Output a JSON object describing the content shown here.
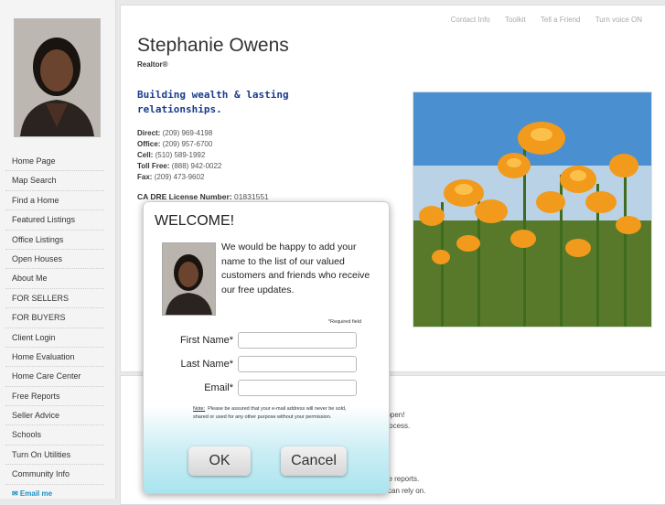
{
  "sidebar": {
    "nav_items": [
      "Home Page",
      "Map Search",
      "Find a Home",
      "Featured Listings",
      "Office Listings",
      "Open Houses",
      "About Me",
      "FOR SELLERS",
      "FOR BUYERS",
      "Client Login",
      "Home Evaluation",
      "Home Care Center",
      "Free Reports",
      "Seller Advice",
      "Schools",
      "Turn On Utilities",
      "Community Info"
    ],
    "email_link": "✉ Email me"
  },
  "top_links": [
    "Contact Info",
    "Toolkit",
    "Tell a Friend",
    "Turn voice ON"
  ],
  "profile": {
    "name": "Stephanie Owens",
    "title": "Realtor®",
    "tagline": "Building wealth & lasting relationships.",
    "phones": [
      {
        "label": "Direct:",
        "value": "(209) 969-4198"
      },
      {
        "label": "Office:",
        "value": "(209) 957-6700"
      },
      {
        "label": "Cell:",
        "value": "(510) 589-1992"
      },
      {
        "label": "Toll Free:",
        "value": "(888) 942-0022"
      },
      {
        "label": "Fax:",
        "value": "(209) 473-9602"
      }
    ],
    "license_label": "CA DRE License Number:",
    "license_value": "01831551"
  },
  "partial_text": {
    "happen": "appen!",
    "process": "process.",
    "reports": "ee reports.",
    "relyon": "can rely on."
  },
  "modal": {
    "title": "WELCOME!",
    "message": "We would be happy to add your name to the list of our valued customers and friends who receive our free updates.",
    "required_note": "*Required field",
    "fields": [
      {
        "label": "First Name*",
        "value": ""
      },
      {
        "label": "Last Name*",
        "value": ""
      },
      {
        "label": "Email*",
        "value": ""
      }
    ],
    "note_label": "Note:",
    "note_text": "Please be assured that your e-mail address will never be sold, shared or used for any other purpose without your permission.",
    "ok_label": "OK",
    "cancel_label": "Cancel"
  }
}
